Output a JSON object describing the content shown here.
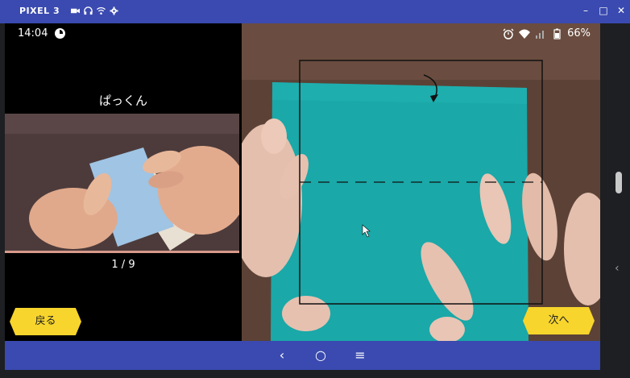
{
  "titlebar": {
    "device": "PIXEL 3",
    "minimize": "–",
    "maximize": "□",
    "close": "✕"
  },
  "status": {
    "time": "14:04",
    "battery": "66%"
  },
  "lesson": {
    "title": "ぱっくん",
    "counter": "1 / 9"
  },
  "buttons": {
    "back": "戻る",
    "next": "次へ"
  },
  "colors": {
    "emulator_bar": "#3a4ab0",
    "button_yellow": "#f7d52c",
    "paper_teal": "#1aa8a8",
    "paper_light_blue": "#9fc4e4"
  },
  "nav": {
    "back_glyph": "‹",
    "home_glyph": "○",
    "recents_glyph": "≡"
  },
  "side": {
    "chevron": "‹"
  }
}
